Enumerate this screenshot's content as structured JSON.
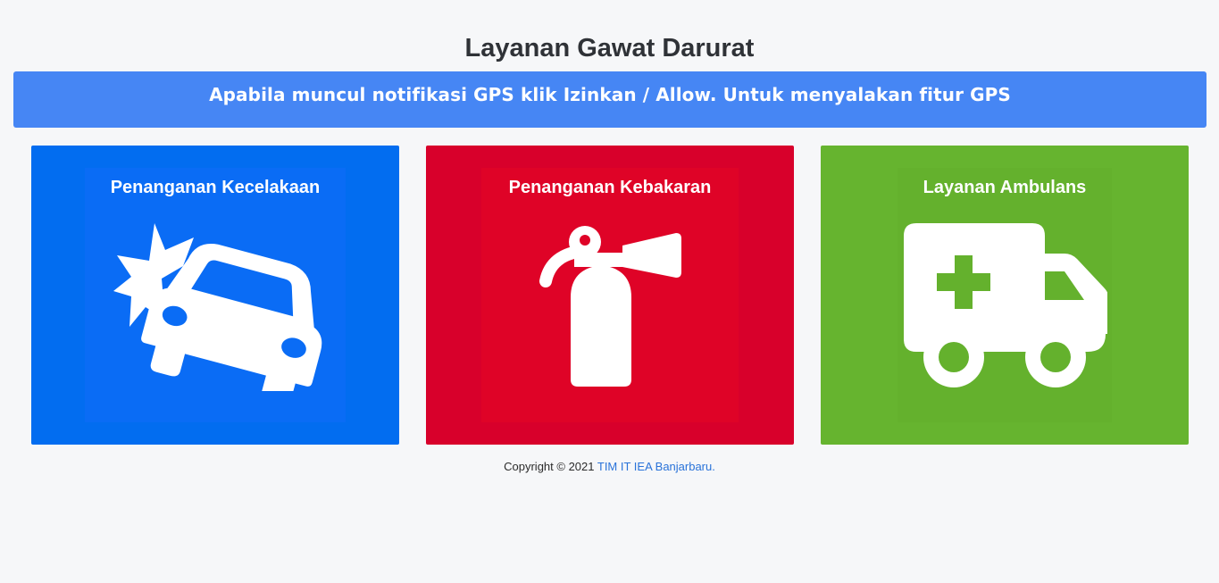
{
  "page": {
    "title": "Layanan Gawat Darurat"
  },
  "banner": {
    "text": "Apabila muncul notifikasi GPS klik Izinkan / Allow. Untuk menyalakan fitur GPS",
    "color": "#4686f4"
  },
  "services": [
    {
      "label": "Penanganan Kecelakaan",
      "icon": "car-crash-icon",
      "color": "#026df0"
    },
    {
      "label": "Penanganan Kebakaran",
      "icon": "fire-extinguisher-icon",
      "color": "#d8002b"
    },
    {
      "label": "Layanan Ambulans",
      "icon": "ambulance-icon",
      "color": "#66b42f"
    }
  ],
  "footer": {
    "copyright": "Copyright © 2021",
    "link_text": "TIM IT IEA Banjarbaru."
  }
}
